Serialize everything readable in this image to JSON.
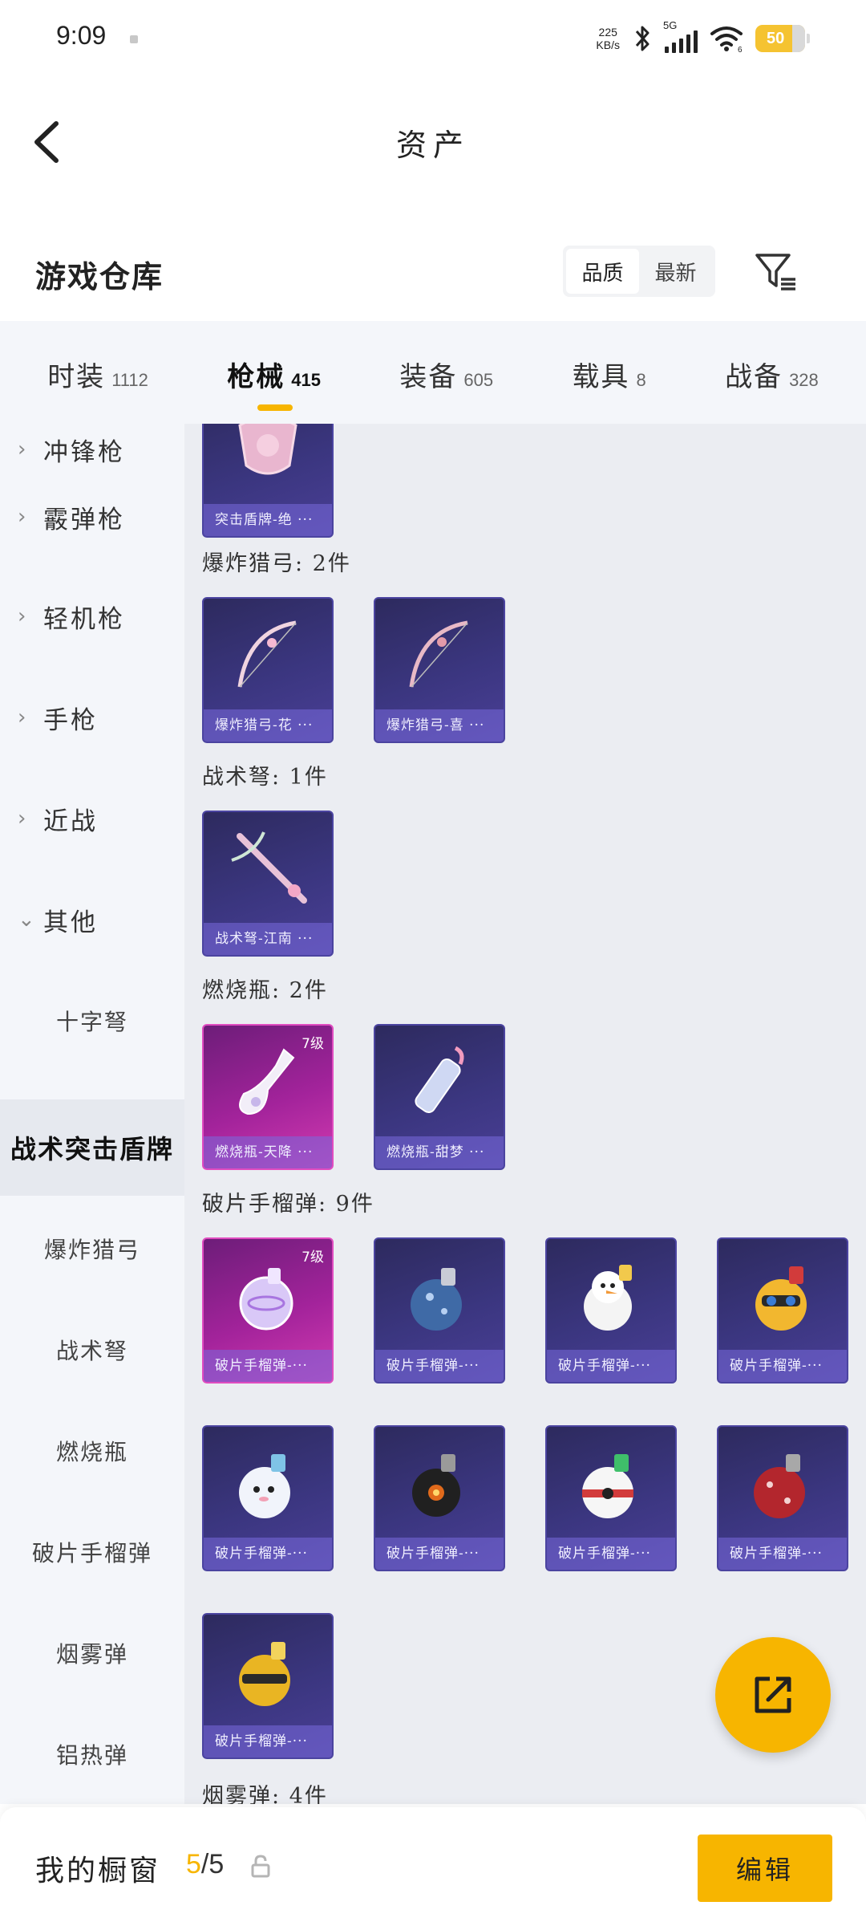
{
  "status": {
    "time": "9:09",
    "net_speed_value": "225",
    "net_speed_unit": "KB/s",
    "network": "5G",
    "wifi_badge": "6",
    "battery": "50"
  },
  "header": {
    "title": "资产"
  },
  "warehouse": {
    "title": "游戏仓库",
    "sort_options": [
      "品质",
      "最新"
    ]
  },
  "tabs": [
    {
      "label": "时装",
      "count": "1112"
    },
    {
      "label": "枪械",
      "count": "415"
    },
    {
      "label": "装备",
      "count": "605"
    },
    {
      "label": "载具",
      "count": "8"
    },
    {
      "label": "战备",
      "count": "328"
    }
  ],
  "categories": [
    {
      "label": "冲锋枪",
      "chev": "›"
    },
    {
      "label": "霰弹枪",
      "chev": "›"
    },
    {
      "label": "轻机枪",
      "chev": "›"
    },
    {
      "label": "手枪",
      "chev": "›"
    },
    {
      "label": "近战",
      "chev": "›"
    },
    {
      "label": "其他",
      "chev": "⌄"
    }
  ],
  "sub_categories": [
    "十字弩",
    "战术突击盾牌",
    "爆炸猎弓",
    "战术弩",
    "燃烧瓶",
    "破片手榴弹",
    "烟雾弹",
    "铝热弹"
  ],
  "groups": [
    {
      "title": "爆炸猎弓: 2件"
    },
    {
      "title": "战术弩: 1件"
    },
    {
      "title": "燃烧瓶: 2件"
    },
    {
      "title": "破片手榴弹: 9件"
    },
    {
      "title": "烟雾弹: 4件"
    }
  ],
  "items": [
    {
      "name": "突击盾牌-绝 ···"
    },
    {
      "name": "爆炸猎弓-花 ···"
    },
    {
      "name": "爆炸猎弓-喜 ···"
    },
    {
      "name": "战术弩-江南 ···"
    },
    {
      "name": "燃烧瓶-天降 ···",
      "level": "7级"
    },
    {
      "name": "燃烧瓶-甜梦 ···"
    },
    {
      "name": "破片手榴弹-···",
      "level": "7级"
    },
    {
      "name": "破片手榴弹-···"
    },
    {
      "name": "破片手榴弹-···"
    },
    {
      "name": "破片手榴弹-···"
    },
    {
      "name": "破片手榴弹-···"
    },
    {
      "name": "破片手榴弹-···"
    },
    {
      "name": "破片手榴弹-···"
    },
    {
      "name": "破片手榴弹-···"
    },
    {
      "name": "破片手榴弹-···"
    }
  ],
  "showcase": {
    "label": "我的橱窗",
    "current": "5",
    "total": "/5",
    "edit_label": "编辑"
  },
  "colors": {
    "accent": "#f7b500",
    "item_purple": "#3b3680",
    "item_pink": "#a3239b"
  },
  "icons": [
    "back-arrow-icon",
    "filter-icon",
    "bluetooth-icon",
    "wifi-icon",
    "lock-icon",
    "share-icon"
  ]
}
